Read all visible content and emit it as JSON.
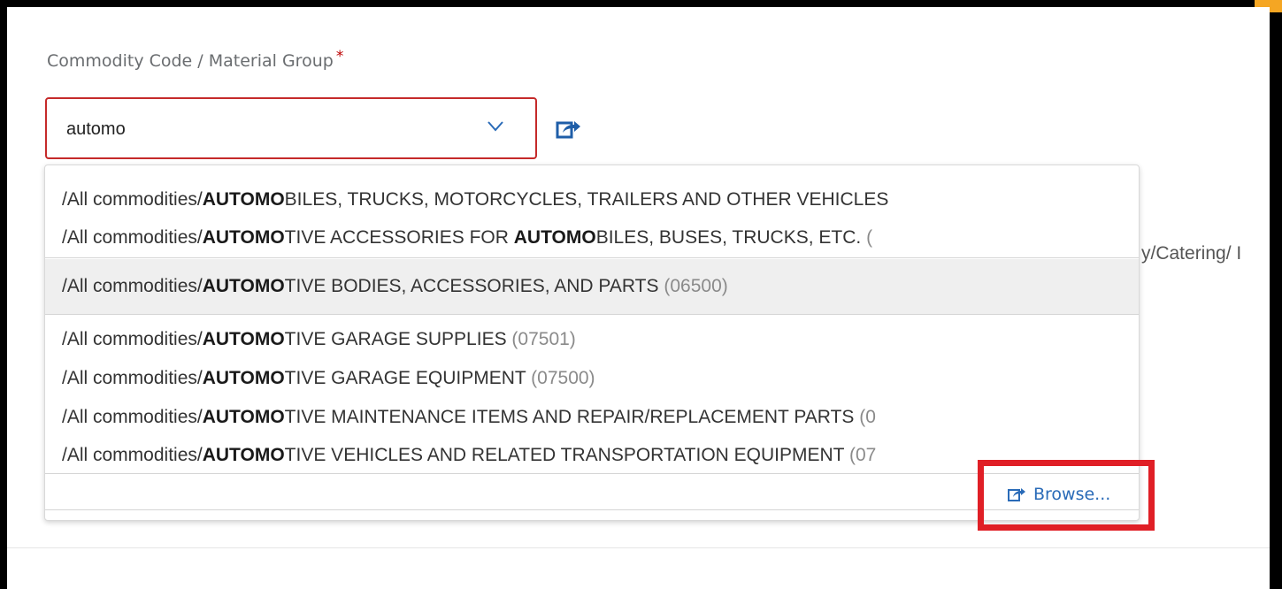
{
  "field": {
    "label": "Commodity Code / Material Group",
    "required_mark": "*",
    "value": "automo"
  },
  "suggestions": [
    {
      "prefix": "/All commodities/",
      "parts": [
        {
          "b": "AUTOMO"
        },
        {
          "t": "BILES, TRUCKS, MOTORCYCLES, TRAILERS AND OTHER VEHICLES"
        }
      ],
      "code": ""
    },
    {
      "prefix": "/All commodities/",
      "parts": [
        {
          "b": "AUTOMO"
        },
        {
          "t": "TIVE ACCESSORIES FOR "
        },
        {
          "b": "AUTOMO"
        },
        {
          "t": "BILES, BUSES, TRUCKS, ETC. "
        }
      ],
      "code": "("
    },
    {
      "prefix": "/All commodities/",
      "parts": [
        {
          "b": "AUTOMO"
        },
        {
          "t": "TIVE BODIES, ACCESSORIES, AND PARTS "
        }
      ],
      "code": "(06500)",
      "selected": true
    },
    {
      "prefix": "/All commodities/",
      "parts": [
        {
          "b": "AUTOMO"
        },
        {
          "t": "TIVE GARAGE SUPPLIES "
        }
      ],
      "code": "(07501)"
    },
    {
      "prefix": "/All commodities/",
      "parts": [
        {
          "b": "AUTOMO"
        },
        {
          "t": "TIVE GARAGE EQUIPMENT "
        }
      ],
      "code": "(07500)"
    },
    {
      "prefix": "/All commodities/",
      "parts": [
        {
          "b": "AUTOMO"
        },
        {
          "t": "TIVE MAINTENANCE ITEMS AND REPAIR/REPLACEMENT PARTS "
        }
      ],
      "code": "(0"
    },
    {
      "prefix": "/All commodities/",
      "parts": [
        {
          "b": "AUTOMO"
        },
        {
          "t": "TIVE VEHICLES AND RELATED TRANSPORTATION EQUIPMENT "
        }
      ],
      "code": "(07"
    }
  ],
  "overflow_text": "y/Catering/ I",
  "browse_label": "Browse...",
  "colors": {
    "accent": "#2a6bb8",
    "error_border": "#c52a2a",
    "annotation": "#e01f26"
  }
}
